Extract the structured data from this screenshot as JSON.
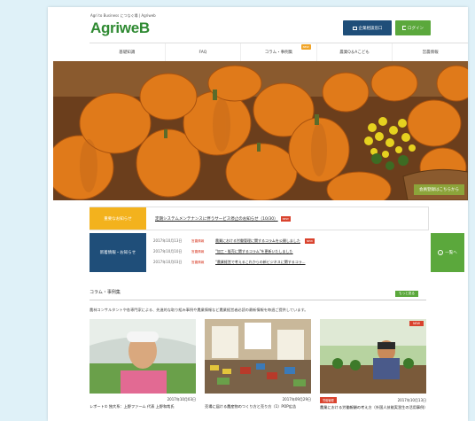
{
  "header": {
    "tagline": "Agri to Business につなぐ場 | Agriweb",
    "logo_text": "AgriweB",
    "consult_button": "企業相談窓口",
    "login_button": "ログイン"
  },
  "nav": {
    "items": [
      {
        "label": "基礎知識",
        "new": ""
      },
      {
        "label": "FAQ",
        "new": ""
      },
      {
        "label": "コラム・事例集",
        "new": "NEW"
      },
      {
        "label": "農業Q＆Aこども",
        "new": ""
      },
      {
        "label": "営農情報",
        "new": ""
      }
    ]
  },
  "hero": {
    "button_label": "会員登録はこちらから"
  },
  "notice": {
    "label": "重要なお知らせ",
    "text": "定期システムメンテナンスに伴うサービス停止のお知らせ（10/30）",
    "badge": "NEW"
  },
  "news": {
    "label": "新着情報・お知らせ",
    "more_label": "一覧へ",
    "items": [
      {
        "date": "2017年10月13日",
        "cat": "営農情報",
        "title": "農業における労働管理に関するコラムを公開しました",
        "badge": "NEW"
      },
      {
        "date": "2017年10月10日",
        "cat": "営農情報",
        "title": "\"加工・販売に関するコラム\"を更新いたしました",
        "badge": ""
      },
      {
        "date": "2017年10月03日",
        "cat": "営農情報",
        "title": "\"農業経営で考えるこれからの新ビジネスに関するコラ...",
        "badge": ""
      }
    ]
  },
  "columns": {
    "heading": "コラム・事例集",
    "more_label": "もっと見る",
    "description": "農林コンサルタントや各専門家による、先進的な取り組み事例や農業情報など農業経営者必読の最新情報を毎週ご提供しています。",
    "cards": [
      {
        "date": "2017年10月03日",
        "title": "レポート① 独大系：上野ファーム 代表 上野和哉氏",
        "new": "",
        "category": ""
      },
      {
        "date": "2017年09月29日",
        "title": "売場に届ける農産物のつくり方と売り方（1）POP広告",
        "new": "",
        "category": ""
      },
      {
        "date": "2017年10月13日",
        "title": "農業における労働報酬の考え方（外国人技能実習生の活用事例）",
        "new": "NEW",
        "category": "労働管理"
      }
    ]
  },
  "colors": {
    "green": "#5ba83c",
    "navy": "#1f4e79",
    "amber": "#f3b21d",
    "red": "#d9432e"
  }
}
